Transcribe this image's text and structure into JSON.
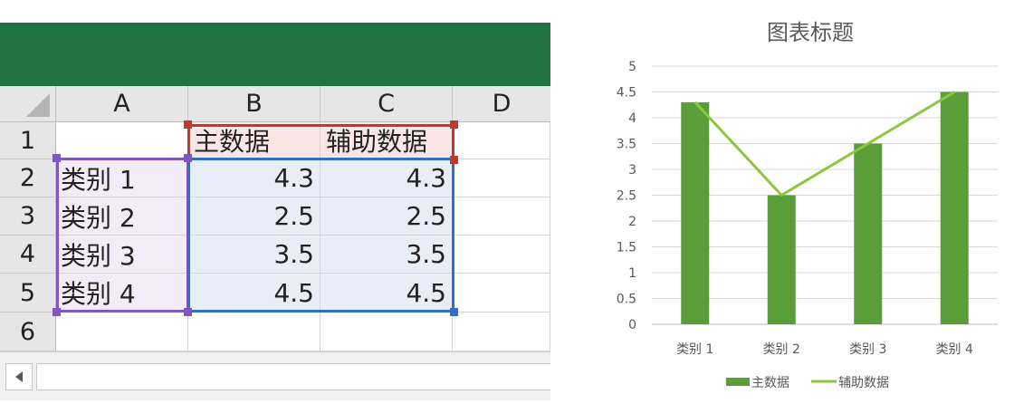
{
  "columns": [
    "A",
    "B",
    "C",
    "D"
  ],
  "rows": [
    "1",
    "2",
    "3",
    "4",
    "5",
    "6"
  ],
  "cells": {
    "B1": "主数据",
    "C1": "辅助数据",
    "A2": "类别 1",
    "B2": "4.3",
    "C2": "4.3",
    "A3": "类别 2",
    "B3": "2.5",
    "C3": "2.5",
    "A4": "类别 3",
    "B4": "3.5",
    "C4": "3.5",
    "A5": "类别 4",
    "B5": "4.5",
    "C5": "4.5"
  },
  "colors": {
    "ribbon": "#217346",
    "bar": "#5a9e3a",
    "line": "#8cc63f",
    "range_series": "#c0392b",
    "range_categories": "#7e57c2",
    "range_values": "#2f6fc4"
  },
  "icons": {
    "scroll_left": "triangle-left-icon"
  },
  "chart_data": {
    "type": "bar",
    "title": "图表标题",
    "categories": [
      "类别 1",
      "类别 2",
      "类别 3",
      "类别 4"
    ],
    "series": [
      {
        "name": "主数据",
        "type": "bar",
        "values": [
          4.3,
          2.5,
          3.5,
          4.5
        ]
      },
      {
        "name": "辅助数据",
        "type": "line",
        "values": [
          4.3,
          2.5,
          3.5,
          4.5
        ]
      }
    ],
    "ylim": [
      0,
      5
    ],
    "yticks": [
      "0",
      "0.5",
      "1",
      "1.5",
      "2",
      "2.5",
      "3",
      "3.5",
      "4",
      "4.5",
      "5"
    ],
    "grid": true,
    "legend": "bottom"
  }
}
